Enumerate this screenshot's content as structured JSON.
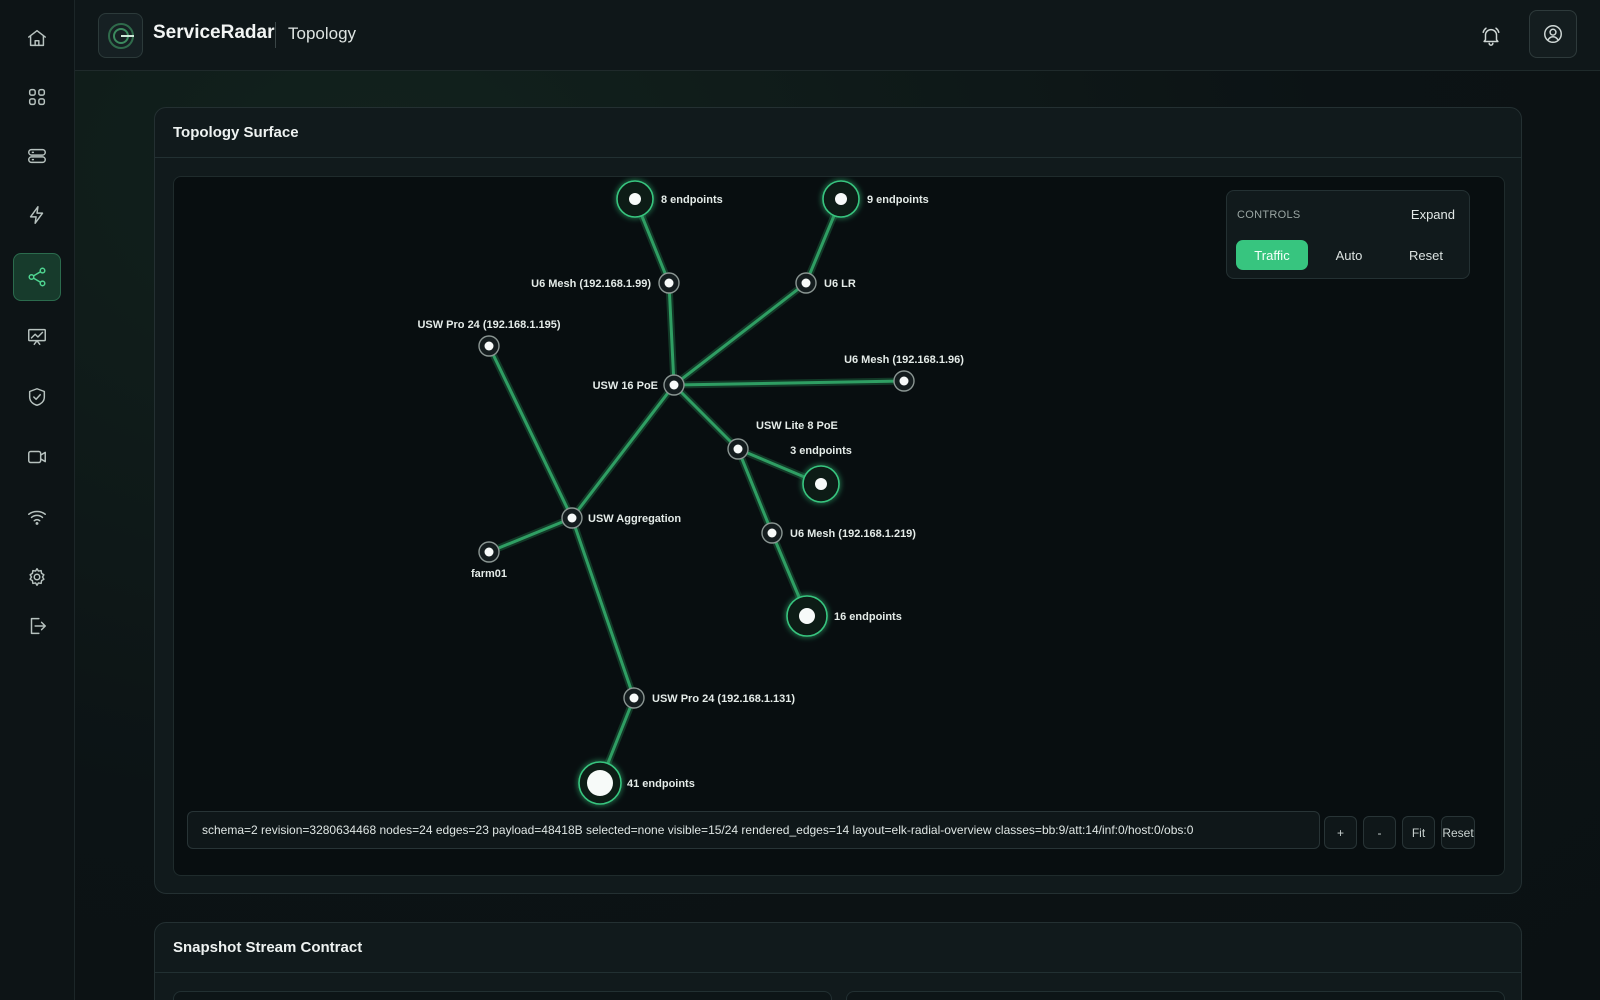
{
  "header": {
    "brand": "ServiceRadar",
    "breadcrumb": "Topology"
  },
  "sidebar": {
    "items": [
      {
        "icon": "home-icon",
        "active": false
      },
      {
        "icon": "grid-icon",
        "active": false
      },
      {
        "icon": "database-icon",
        "active": false
      },
      {
        "icon": "lightning-icon",
        "active": false
      },
      {
        "icon": "share-icon",
        "active": true
      },
      {
        "icon": "chart-board-icon",
        "active": false
      },
      {
        "icon": "shield-icon",
        "active": false
      },
      {
        "icon": "camera-icon",
        "active": false
      },
      {
        "icon": "wifi-icon",
        "active": false
      },
      {
        "icon": "gear-icon",
        "active": false
      },
      {
        "icon": "logout-icon",
        "active": false
      }
    ]
  },
  "topology": {
    "title": "Topology Surface",
    "controls": {
      "title": "CONTROLS",
      "expand": "Expand",
      "traffic": "Traffic",
      "auto": "Auto",
      "reset": "Reset"
    },
    "status_text": "schema=2 revision=3280634468 nodes=24 edges=23 payload=48418B selected=none visible=15/24 rendered_edges=14 layout=elk-radial-overview classes=bb:9/att:14/inf:0/host:0/obs:0",
    "zoom": {
      "plus": "+",
      "minus": "-",
      "fit": "Fit",
      "reset": "Reset"
    },
    "nodes": [
      {
        "id": "ep8",
        "label": "8 endpoints",
        "kind": "endpoints",
        "size": 8
      },
      {
        "id": "ep9",
        "label": "9 endpoints",
        "kind": "endpoints",
        "size": 9
      },
      {
        "id": "u6mesh99",
        "label": "U6 Mesh (192.168.1.99)",
        "kind": "device"
      },
      {
        "id": "u6lr",
        "label": "U6 LR",
        "kind": "device"
      },
      {
        "id": "uswpro195",
        "label": "USW Pro 24 (192.168.1.195)",
        "kind": "device"
      },
      {
        "id": "usw16",
        "label": "USW 16 PoE",
        "kind": "device"
      },
      {
        "id": "u6mesh96",
        "label": "U6 Mesh (192.168.1.96)",
        "kind": "device"
      },
      {
        "id": "uswlite",
        "label": "USW Lite 8 PoE",
        "kind": "device"
      },
      {
        "id": "ep3",
        "label": "3 endpoints",
        "kind": "endpoints",
        "size": 3
      },
      {
        "id": "uswagg",
        "label": "USW Aggregation",
        "kind": "device"
      },
      {
        "id": "u6mesh219",
        "label": "U6 Mesh (192.168.1.219)",
        "kind": "device"
      },
      {
        "id": "farm01",
        "label": "farm01",
        "kind": "device"
      },
      {
        "id": "ep16",
        "label": "16 endpoints",
        "kind": "endpoints",
        "size": 16
      },
      {
        "id": "uswpro131",
        "label": "USW Pro 24 (192.168.1.131)",
        "kind": "device"
      },
      {
        "id": "ep41",
        "label": "41 endpoints",
        "kind": "endpoints",
        "size": 41
      }
    ],
    "edges": [
      [
        "ep8",
        "u6mesh99"
      ],
      [
        "ep9",
        "u6lr"
      ],
      [
        "u6mesh99",
        "usw16"
      ],
      [
        "u6lr",
        "usw16"
      ],
      [
        "usw16",
        "u6mesh96"
      ],
      [
        "usw16",
        "uswlite"
      ],
      [
        "usw16",
        "uswagg"
      ],
      [
        "uswlite",
        "ep3"
      ],
      [
        "uswlite",
        "u6mesh219"
      ],
      [
        "u6mesh219",
        "ep16"
      ],
      [
        "uswpro195",
        "uswagg"
      ],
      [
        "uswagg",
        "farm01"
      ],
      [
        "uswagg",
        "uswpro131"
      ],
      [
        "uswpro131",
        "ep41"
      ]
    ]
  },
  "snapshot": {
    "title": "Snapshot Stream Contract"
  },
  "colors": {
    "accent": "#37c57f",
    "edge": "#2f9e63",
    "background": "#080e10"
  }
}
